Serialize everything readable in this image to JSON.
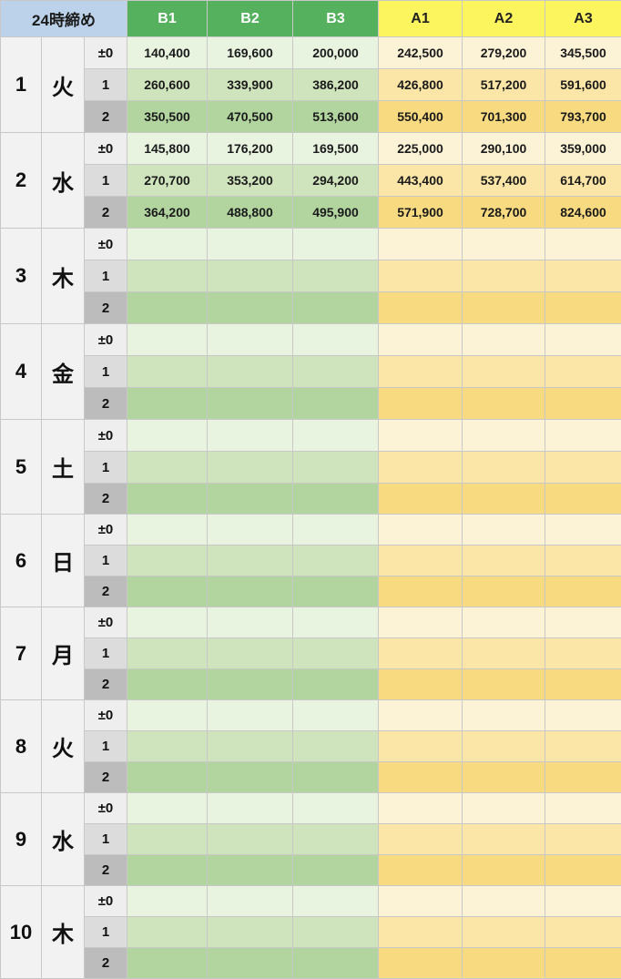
{
  "header": {
    "corner_label": "24時締め",
    "columns": [
      "B1",
      "B2",
      "B3",
      "A1",
      "A2",
      "A3"
    ]
  },
  "level_labels": [
    "±0",
    "1",
    "2"
  ],
  "colors": {
    "b_header": "#55b15e",
    "a_header": "#fdf55e",
    "corner": "#bcd2ea"
  },
  "days": [
    {
      "day": "1",
      "dow": "火",
      "rows": [
        [
          "140,400",
          "169,600",
          "200,000",
          "242,500",
          "279,200",
          "345,500"
        ],
        [
          "260,600",
          "339,900",
          "386,200",
          "426,800",
          "517,200",
          "591,600"
        ],
        [
          "350,500",
          "470,500",
          "513,600",
          "550,400",
          "701,300",
          "793,700"
        ]
      ]
    },
    {
      "day": "2",
      "dow": "水",
      "rows": [
        [
          "145,800",
          "176,200",
          "169,500",
          "225,000",
          "290,100",
          "359,000"
        ],
        [
          "270,700",
          "353,200",
          "294,200",
          "443,400",
          "537,400",
          "614,700"
        ],
        [
          "364,200",
          "488,800",
          "495,900",
          "571,900",
          "728,700",
          "824,600"
        ]
      ]
    },
    {
      "day": "3",
      "dow": "木",
      "rows": [
        [
          "",
          "",
          "",
          "",
          "",
          ""
        ],
        [
          "",
          "",
          "",
          "",
          "",
          ""
        ],
        [
          "",
          "",
          "",
          "",
          "",
          ""
        ]
      ]
    },
    {
      "day": "4",
      "dow": "金",
      "rows": [
        [
          "",
          "",
          "",
          "",
          "",
          ""
        ],
        [
          "",
          "",
          "",
          "",
          "",
          ""
        ],
        [
          "",
          "",
          "",
          "",
          "",
          ""
        ]
      ]
    },
    {
      "day": "5",
      "dow": "土",
      "rows": [
        [
          "",
          "",
          "",
          "",
          "",
          ""
        ],
        [
          "",
          "",
          "",
          "",
          "",
          ""
        ],
        [
          "",
          "",
          "",
          "",
          "",
          ""
        ]
      ]
    },
    {
      "day": "6",
      "dow": "日",
      "rows": [
        [
          "",
          "",
          "",
          "",
          "",
          ""
        ],
        [
          "",
          "",
          "",
          "",
          "",
          ""
        ],
        [
          "",
          "",
          "",
          "",
          "",
          ""
        ]
      ]
    },
    {
      "day": "7",
      "dow": "月",
      "rows": [
        [
          "",
          "",
          "",
          "",
          "",
          ""
        ],
        [
          "",
          "",
          "",
          "",
          "",
          ""
        ],
        [
          "",
          "",
          "",
          "",
          "",
          ""
        ]
      ]
    },
    {
      "day": "8",
      "dow": "火",
      "rows": [
        [
          "",
          "",
          "",
          "",
          "",
          ""
        ],
        [
          "",
          "",
          "",
          "",
          "",
          ""
        ],
        [
          "",
          "",
          "",
          "",
          "",
          ""
        ]
      ]
    },
    {
      "day": "9",
      "dow": "水",
      "rows": [
        [
          "",
          "",
          "",
          "",
          "",
          ""
        ],
        [
          "",
          "",
          "",
          "",
          "",
          ""
        ],
        [
          "",
          "",
          "",
          "",
          "",
          ""
        ]
      ]
    },
    {
      "day": "10",
      "dow": "木",
      "rows": [
        [
          "",
          "",
          "",
          "",
          "",
          ""
        ],
        [
          "",
          "",
          "",
          "",
          "",
          ""
        ],
        [
          "",
          "",
          "",
          "",
          "",
          ""
        ]
      ]
    }
  ]
}
